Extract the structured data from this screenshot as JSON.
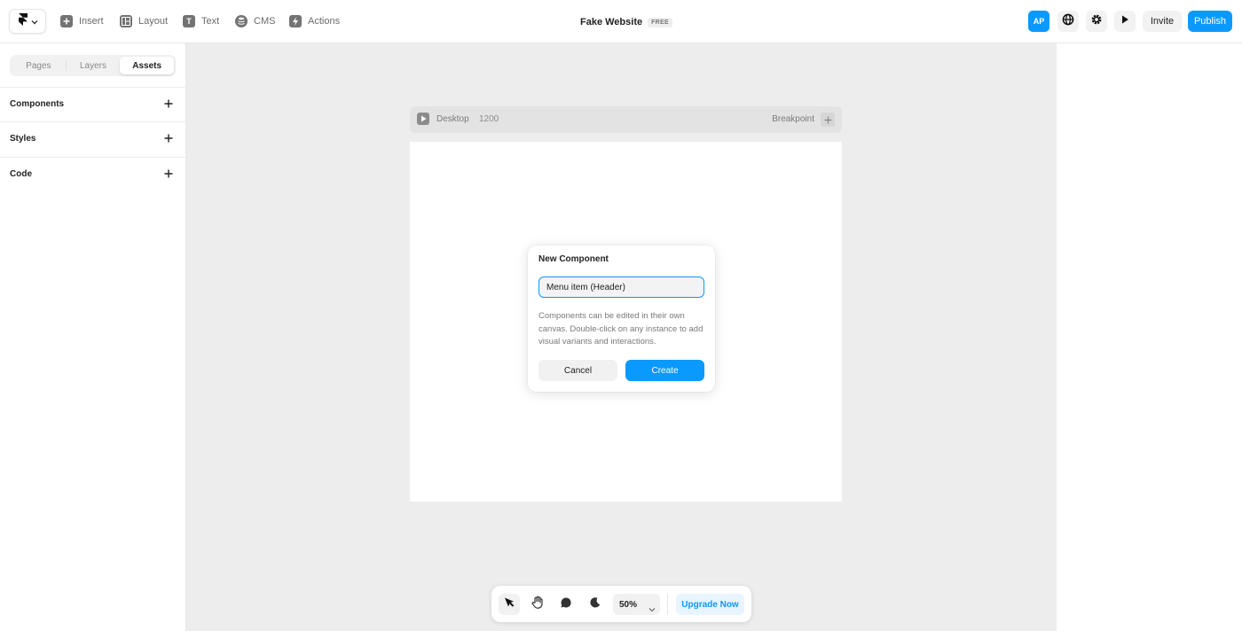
{
  "toolbar": {
    "items": [
      {
        "label": "Insert",
        "icon": "plus-square-icon"
      },
      {
        "label": "Layout",
        "icon": "layout-icon"
      },
      {
        "label": "Text",
        "icon": "text-icon"
      },
      {
        "label": "CMS",
        "icon": "database-icon"
      },
      {
        "label": "Actions",
        "icon": "bolt-icon"
      }
    ],
    "project_title": "Fake Website",
    "plan_badge": "FREE",
    "avatar_initials": "AP",
    "invite_label": "Invite",
    "publish_label": "Publish"
  },
  "sidebar": {
    "tabs": [
      "Pages",
      "Layers",
      "Assets"
    ],
    "active_tab": "Assets",
    "sections": [
      "Components",
      "Styles",
      "Code"
    ]
  },
  "canvas": {
    "frame_name": "Desktop",
    "frame_width": "1200",
    "breakpoint_label": "Breakpoint"
  },
  "modal": {
    "title": "New Component",
    "input_value": "Menu item (Header)",
    "description": "Components can be edited in their own canvas. Double-click on any instance to add visual variants and interactions.",
    "cancel_label": "Cancel",
    "create_label": "Create"
  },
  "bottom_toolbar": {
    "zoom": "50%",
    "upgrade_label": "Upgrade Now"
  },
  "colors": {
    "accent": "#0a99ff",
    "canvas_bg": "#ededed"
  }
}
